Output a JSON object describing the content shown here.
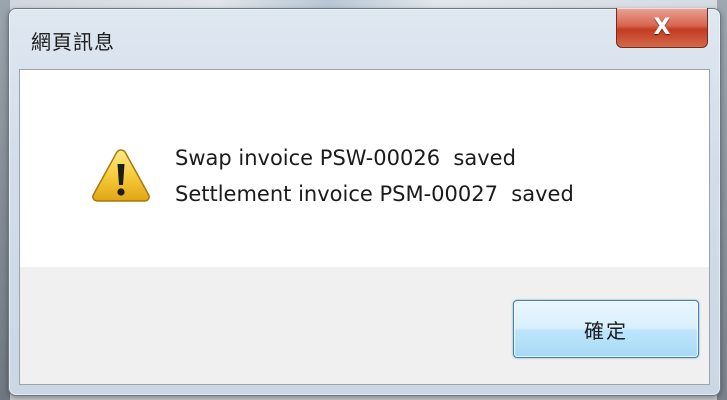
{
  "dialog": {
    "title": "網頁訊息",
    "close_label": "X",
    "icon": "warning-icon",
    "messages": [
      "Swap invoice PSW-00026  saved",
      "Settlement invoice PSM-00027  saved"
    ],
    "ok_label": "確定"
  },
  "colors": {
    "close_button": "#c9432b",
    "ok_border": "#3c7fb1",
    "warning_fill": "#f4c430"
  }
}
